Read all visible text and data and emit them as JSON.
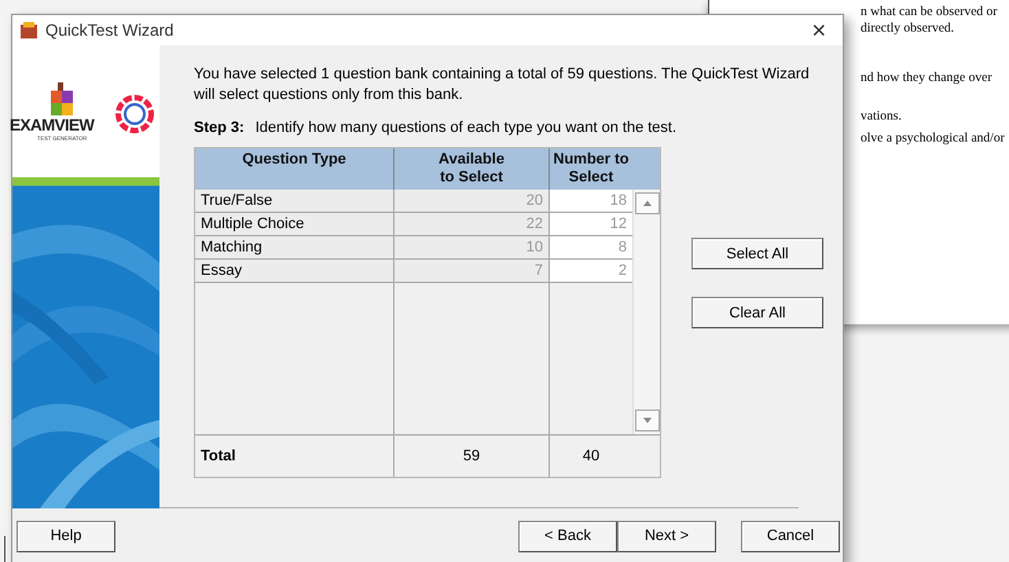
{
  "background_document": {
    "lines": [
      "n what can be observed or",
      "directly observed.",
      "nd how they change over",
      "vations.",
      "olve a psychological and/or"
    ]
  },
  "window": {
    "title": "QuickTest Wizard",
    "close": "×"
  },
  "logo": {
    "name": "EXAMVIEW",
    "tagline": "TEST GENERATOR"
  },
  "intro": "You have selected 1 question bank containing a total of 59 questions.  The QuickTest Wizard will select questions only from this bank.",
  "step": {
    "label": "Step 3:",
    "text": "Identify how many questions of each type you want on the test."
  },
  "table": {
    "columns": [
      "Question Type",
      "Available to Select",
      "Number to Select"
    ],
    "rows": [
      {
        "type": "True/False",
        "available": "20",
        "number": "18"
      },
      {
        "type": "Multiple Choice",
        "available": "22",
        "number": "12"
      },
      {
        "type": "Matching",
        "available": "10",
        "number": "8"
      },
      {
        "type": "Essay",
        "available": "7",
        "number": "2"
      }
    ],
    "total": {
      "label": "Total",
      "available": "59",
      "number": "40"
    }
  },
  "side_buttons": [
    "Select All",
    "Clear All"
  ],
  "footer_buttons": [
    {
      "label": "Help",
      "kind": "left"
    },
    {
      "label": "< Back",
      "kind": "nav"
    },
    {
      "label": "Next >",
      "kind": "nav"
    },
    {
      "label": "Cancel",
      "kind": "right"
    }
  ]
}
